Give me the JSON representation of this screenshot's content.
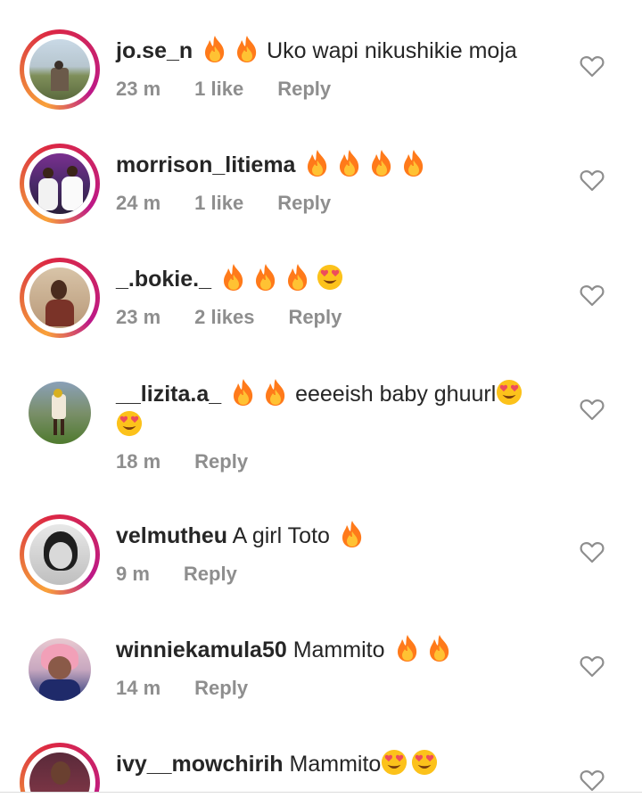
{
  "comments": [
    {
      "username": "jo.se_n",
      "text_before": "",
      "emojis_before": [
        "fire",
        "fire"
      ],
      "text": "Uko wapi nikushikie moja",
      "emojis_after": [],
      "time": "23 m",
      "likes": "1 like",
      "reply": "Reply",
      "story_ring": true,
      "liked": false
    },
    {
      "username": "morrison_litiema",
      "text_before": "",
      "emojis_before": [
        "fire",
        "fire",
        "fire",
        "fire"
      ],
      "text": "",
      "emojis_after": [],
      "time": "24 m",
      "likes": "1 like",
      "reply": "Reply",
      "story_ring": true,
      "liked": false
    },
    {
      "username": "_.bokie._",
      "text_before": "",
      "emojis_before": [
        "fire",
        "fire",
        "fire",
        "heart-eyes"
      ],
      "text": "",
      "emojis_after": [],
      "time": "23 m",
      "likes": "2 likes",
      "reply": "Reply",
      "story_ring": true,
      "liked": false
    },
    {
      "username": "__lizita.a_",
      "text_before": "",
      "emojis_before": [
        "fire",
        "fire"
      ],
      "text": "eeeeish baby ghuurl",
      "emojis_after": [
        "heart-eyes",
        "heart-eyes"
      ],
      "time": "18 m",
      "likes": "",
      "reply": "Reply",
      "story_ring": false,
      "liked": false
    },
    {
      "username": "velmutheu",
      "text_before": "A girl Toto",
      "emojis_before": [
        "fire"
      ],
      "text": "",
      "emojis_after": [],
      "time": "9 m",
      "likes": "",
      "reply": "Reply",
      "story_ring": true,
      "liked": false
    },
    {
      "username": "winniekamula50",
      "text_before": "Mammito",
      "emojis_before": [
        "fire",
        "fire"
      ],
      "text": "",
      "emojis_after": [],
      "time": "14 m",
      "likes": "",
      "reply": "Reply",
      "story_ring": false,
      "liked": false
    },
    {
      "username": "ivy__mowchirih",
      "text_before": "Mammito",
      "emojis_before": [
        "heart-eyes",
        "heart-eyes"
      ],
      "text": "",
      "emojis_after": [],
      "time": "",
      "likes": "",
      "reply": "",
      "story_ring": true,
      "liked": false
    }
  ],
  "icons": {
    "like": "heart-outline-icon",
    "fire": "fire-emoji-icon",
    "heart_eyes": "heart-eyes-emoji-icon"
  },
  "colors": {
    "username": "#262626",
    "meta": "#8e8e8e",
    "heart_outline": "#8e8e8e",
    "ring_start": "#f9a13a",
    "ring_end": "#bc1888"
  }
}
